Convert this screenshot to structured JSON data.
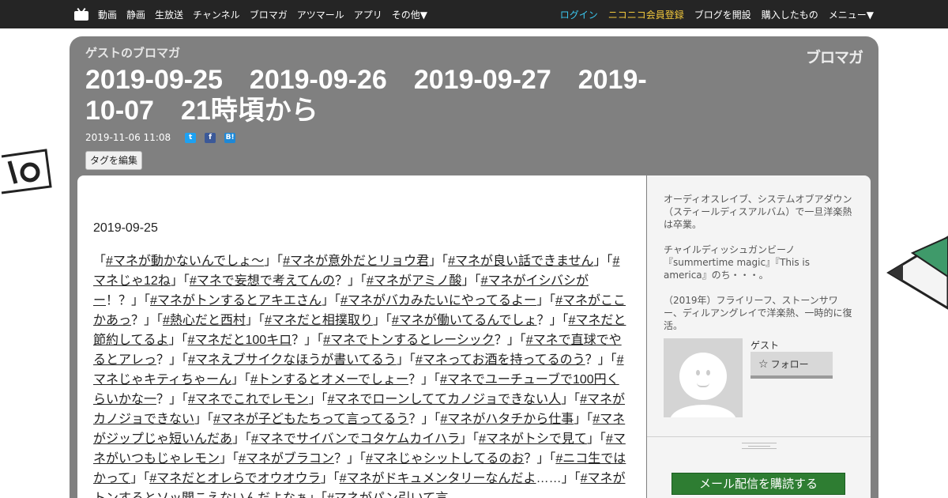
{
  "nav": {
    "left_items": [
      "動画",
      "静画",
      "生放送",
      "チャンネル",
      "ブロマガ",
      "アツマール",
      "アプリ",
      "その他▼"
    ],
    "login": "ログイン",
    "register": "ニコニコ会員登録",
    "open_blog": "ブログを開設",
    "purchased": "購入したもの",
    "menu": "メニュー▼"
  },
  "blog": {
    "name": "ゲストのブロマガ",
    "brand": "ブロマガ"
  },
  "article": {
    "title": "2019-09-25　2019-09-26　2019-09-27　2019-10-07　21時頃から",
    "published": "2019-11-06 11:08",
    "share_icons": [
      "twitter-icon",
      "facebook-icon",
      "hatena-bookmark-icon"
    ],
    "tag_edit_label": "タグを編集",
    "post_date": "2019-09-25",
    "body": [
      {
        "t": "「"
      },
      {
        "l": "#マネが動かないんでしょ〜"
      },
      {
        "t": "」「"
      },
      {
        "l": "#マネが意外だとリョウ君"
      },
      {
        "t": "」「"
      },
      {
        "l": "#マネが良い話できません"
      },
      {
        "t": "」「"
      },
      {
        "l": "#マネじゃ12ね"
      },
      {
        "t": "」「"
      },
      {
        "l": "#マネで妄想で考えてんの"
      },
      {
        "t": "？」「"
      },
      {
        "l": "#マネがアミノ酸"
      },
      {
        "t": "」「"
      },
      {
        "l": "#マネがイシバシがー"
      },
      {
        "t": "！？」「"
      },
      {
        "l": "#マネがトンするとアキエさん"
      },
      {
        "t": "」「"
      },
      {
        "l": "#マネがバカみたいにやってるよー"
      },
      {
        "t": "」「"
      },
      {
        "l": "#マネがここかあっ"
      },
      {
        "t": "？」「"
      },
      {
        "l": "#熱心だと西村"
      },
      {
        "t": "」「"
      },
      {
        "l": "#マネだと相撲取り"
      },
      {
        "t": "」「"
      },
      {
        "l": "#マネが働いてるんでしょ"
      },
      {
        "t": "？」「"
      },
      {
        "l": "#マネだと節約してるよ"
      },
      {
        "t": "」「"
      },
      {
        "l": "#マネだと100キロ"
      },
      {
        "t": "？」「"
      },
      {
        "l": "#マネでトンするとレーシック"
      },
      {
        "t": "？」「"
      },
      {
        "l": "#マネで直球でやるとアレっ"
      },
      {
        "t": "？」「"
      },
      {
        "l": "#マネえブサイクなほうが書いてるう"
      },
      {
        "t": "」「"
      },
      {
        "l": "#マネってお酒を持ってるのう"
      },
      {
        "t": "？」「"
      },
      {
        "l": "#マネじゃキティちゃーん"
      },
      {
        "t": "」「"
      },
      {
        "l": "#トンするとオメーでしょー"
      },
      {
        "t": "？」「"
      },
      {
        "l": "#マネでユーチューブで100円くらいかな一"
      },
      {
        "t": "？」「"
      },
      {
        "l": "#マネでこれでレモン"
      },
      {
        "t": "」「"
      },
      {
        "l": "#マネでローンしててカノジョできない人"
      },
      {
        "t": "」「"
      },
      {
        "l": "#マネがカノジョできない"
      },
      {
        "t": "」「"
      },
      {
        "l": "#マネが子どもたちって言ってるう"
      },
      {
        "t": "？」「"
      },
      {
        "l": "#マネがハタチから仕事"
      },
      {
        "t": "」「"
      },
      {
        "l": "#マネがジップじゃ短いんだあ"
      },
      {
        "t": "」「"
      },
      {
        "l": "#マネでサイバンでコタケムカイハラ"
      },
      {
        "t": "」「"
      },
      {
        "l": "#マネがトシで見て"
      },
      {
        "t": "」「"
      },
      {
        "l": "#マネがいつもじゃレモン"
      },
      {
        "t": "」「"
      },
      {
        "l": "#マネがブラコン"
      },
      {
        "t": "？」「"
      },
      {
        "l": "#マネじゃシットしてるのお"
      },
      {
        "t": "？」「"
      },
      {
        "l": "#ニコ生ではかって"
      },
      {
        "t": "」「"
      },
      {
        "l": "#マネだとオレらでオウオウラ"
      },
      {
        "t": "」「"
      },
      {
        "l": "#マネがドキュメンタリーなんだよ"
      },
      {
        "t": "……」「"
      },
      {
        "l": "#マネがトンするとソッ聞こえないんだよなぁ"
      },
      {
        "t": "」「"
      },
      {
        "l": "#マネがパン引いて言"
      }
    ]
  },
  "sidebar": {
    "profile": [
      "オーディオスレイブ、システムオブアダウン（スティールディスアルバム）で一旦洋楽熱は卒業。",
      "チャイルディッシュガンビーノ『summertime magic』『This is america』のち・・・。",
      "（2019年）フライリーフ、ストーンサワー、ディルアングレイで洋楽熱、一時的に復活。"
    ],
    "user_name": "ゲスト",
    "follow_label": "フォロー",
    "subscribe_label": "メール配信を購読する"
  }
}
